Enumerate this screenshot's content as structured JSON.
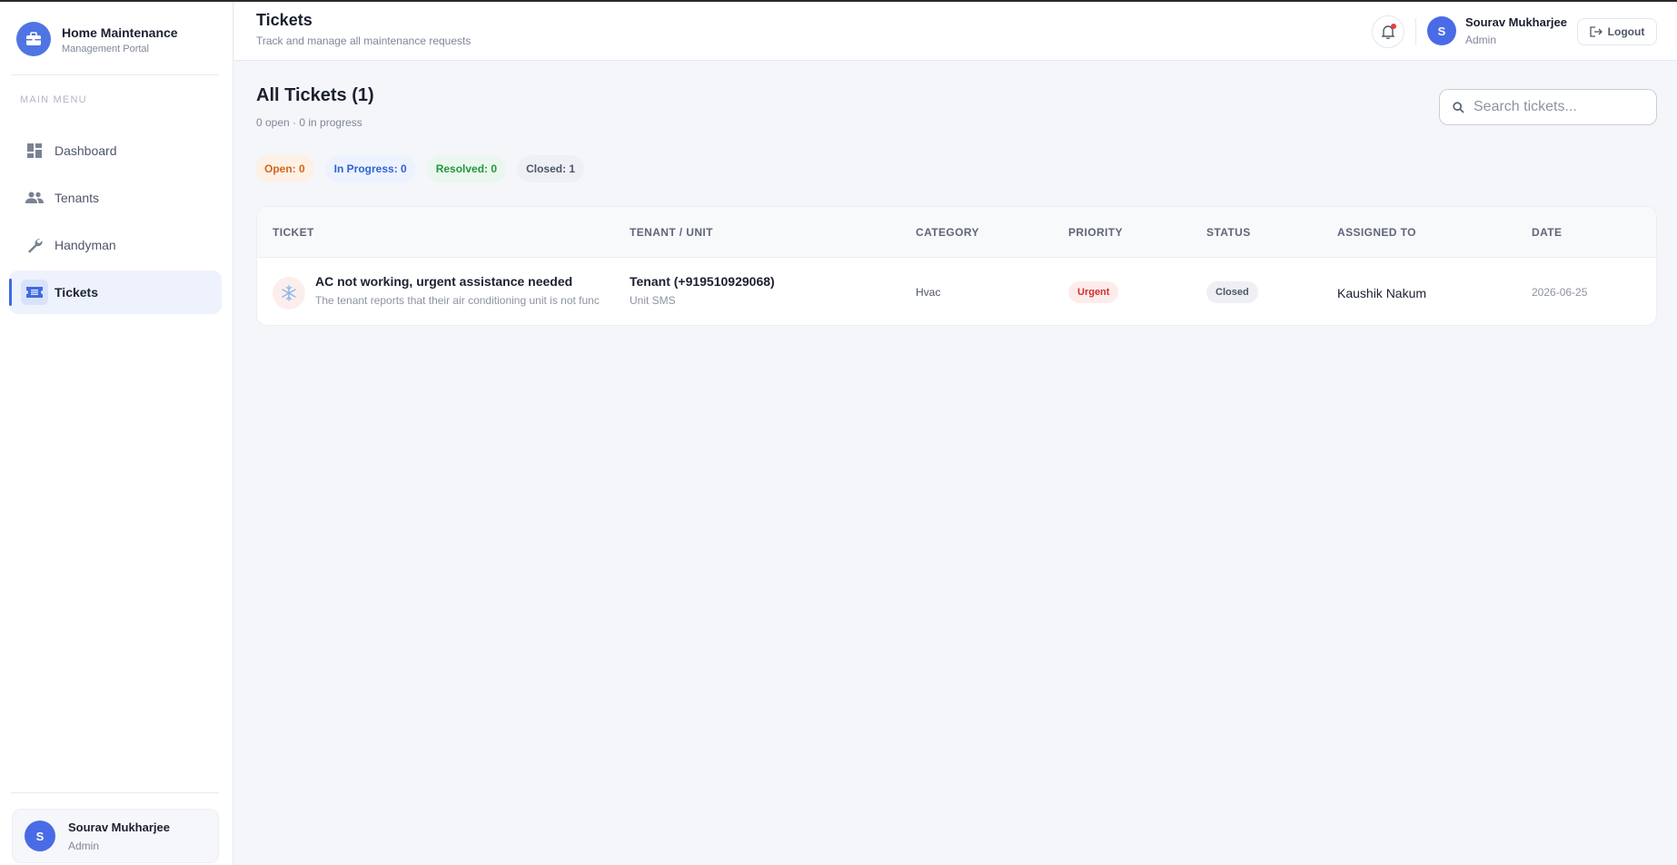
{
  "brand": {
    "title": "Home Maintenance",
    "subtitle": "Management Portal"
  },
  "sidebar": {
    "menu_label": "MAIN MENU",
    "items": [
      {
        "label": "Dashboard",
        "icon": "dashboard-icon"
      },
      {
        "label": "Tenants",
        "icon": "people-icon"
      },
      {
        "label": "Handyman",
        "icon": "wrench-icon"
      },
      {
        "label": "Tickets",
        "icon": "ticket-icon",
        "active": true
      }
    ],
    "user": {
      "initial": "S",
      "name": "Sourav Mukharjee",
      "role": "Admin"
    }
  },
  "header": {
    "title": "Tickets",
    "subtitle": "Track and manage all maintenance requests",
    "user": {
      "initial": "S",
      "name": "Sourav Mukharjee",
      "role": "Admin"
    },
    "logout_label": "Logout"
  },
  "main": {
    "title": "All Tickets (1)",
    "subtitle": "0 open · 0 in progress",
    "search": {
      "placeholder": "Search tickets..."
    },
    "pills": {
      "open": "Open: 0",
      "in_progress": "In Progress: 0",
      "resolved": "Resolved: 0",
      "closed": "Closed: 1"
    },
    "table": {
      "columns": [
        "TICKET",
        "TENANT / UNIT",
        "CATEGORY",
        "PRIORITY",
        "STATUS",
        "ASSIGNED TO",
        "DATE"
      ],
      "rows": [
        {
          "icon": "snowflake-icon",
          "title": "AC not working, urgent assistance needed",
          "description": "The tenant reports that their air conditioning unit is not func",
          "tenant": "Tenant (+919510929068)",
          "unit": "Unit SMS",
          "category": "Hvac",
          "priority": "Urgent",
          "status": "Closed",
          "assigned_to": "Kaushik Nakum",
          "date": "2026-06-25"
        }
      ]
    }
  },
  "colors": {
    "accent": "#4f74e3",
    "urgent": "#d22f2f",
    "open": "#d3661d",
    "in_progress": "#2f62d4",
    "resolved": "#23963f"
  }
}
